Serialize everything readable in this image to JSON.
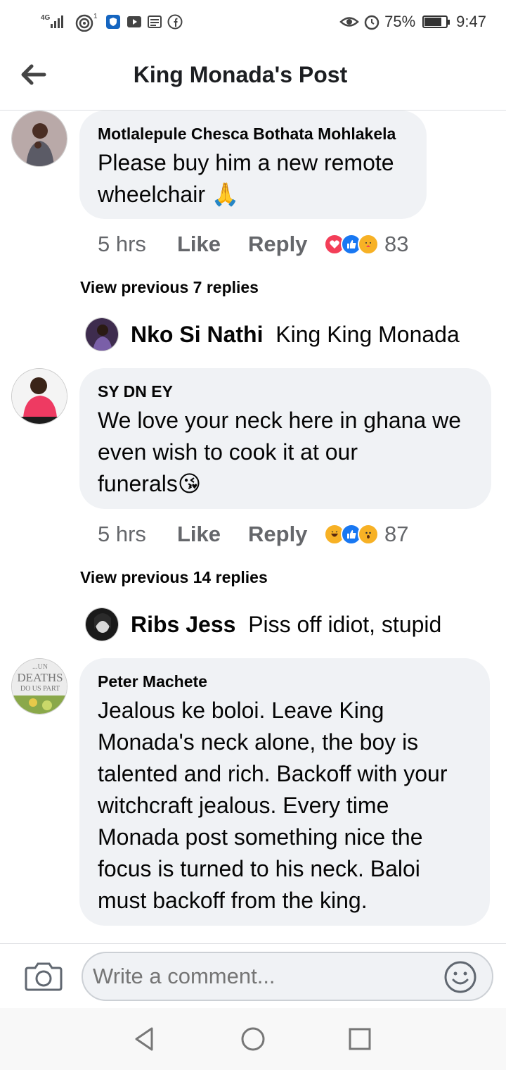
{
  "status_bar": {
    "network": "4G",
    "notification_count": "1",
    "battery": "75%",
    "time": "9:47"
  },
  "header": {
    "title": "King Monada's Post"
  },
  "comments": [
    {
      "author": "Motlalepule Chesca Bothata Mohlakela",
      "text_line1": "Please buy him a new remote",
      "text_line2": "wheelchair 🙏",
      "time": "5 hrs",
      "like_label": "Like",
      "reply_label": "Reply",
      "reaction_count": "83",
      "reaction_icons": [
        "love",
        "like",
        "care"
      ],
      "view_previous": "View previous 7 replies",
      "latest_reply": {
        "author": "Nko Si Nathi",
        "text": "King King Monada"
      }
    },
    {
      "author": "SY DN EY",
      "text_line1": "We love your neck here in ghana we",
      "text_line2": "even wish  to cook it at our",
      "text_line3": "funerals😘",
      "time": "5 hrs",
      "like_label": "Like",
      "reply_label": "Reply",
      "reaction_count": "87",
      "reaction_icons": [
        "haha",
        "like",
        "wow"
      ],
      "view_previous": "View previous 14 replies",
      "latest_reply": {
        "author": "Ribs Jess",
        "text": "Piss off idiot, stupid"
      }
    },
    {
      "author": "Peter Machete",
      "lines": [
        "Jealous ke boloi. Leave King",
        "Monada's neck alone, the boy is",
        "talented and rich. Backoff with your",
        "witchcraft jealous. Every time",
        "Monada post something nice the",
        "focus is turned to his neck. Baloi",
        "must backoff from the king."
      ],
      "avatar_text_1": "...UN",
      "avatar_text_2": "DEATHS",
      "avatar_text_3": "DO US PART"
    }
  ],
  "composer": {
    "placeholder": "Write a comment..."
  },
  "colors": {
    "bubble": "#f0f2f5",
    "meta_text": "#65676b",
    "like_blue": "#1877f2",
    "love_red": "#f33e58",
    "haha_yellow": "#f7b125"
  }
}
